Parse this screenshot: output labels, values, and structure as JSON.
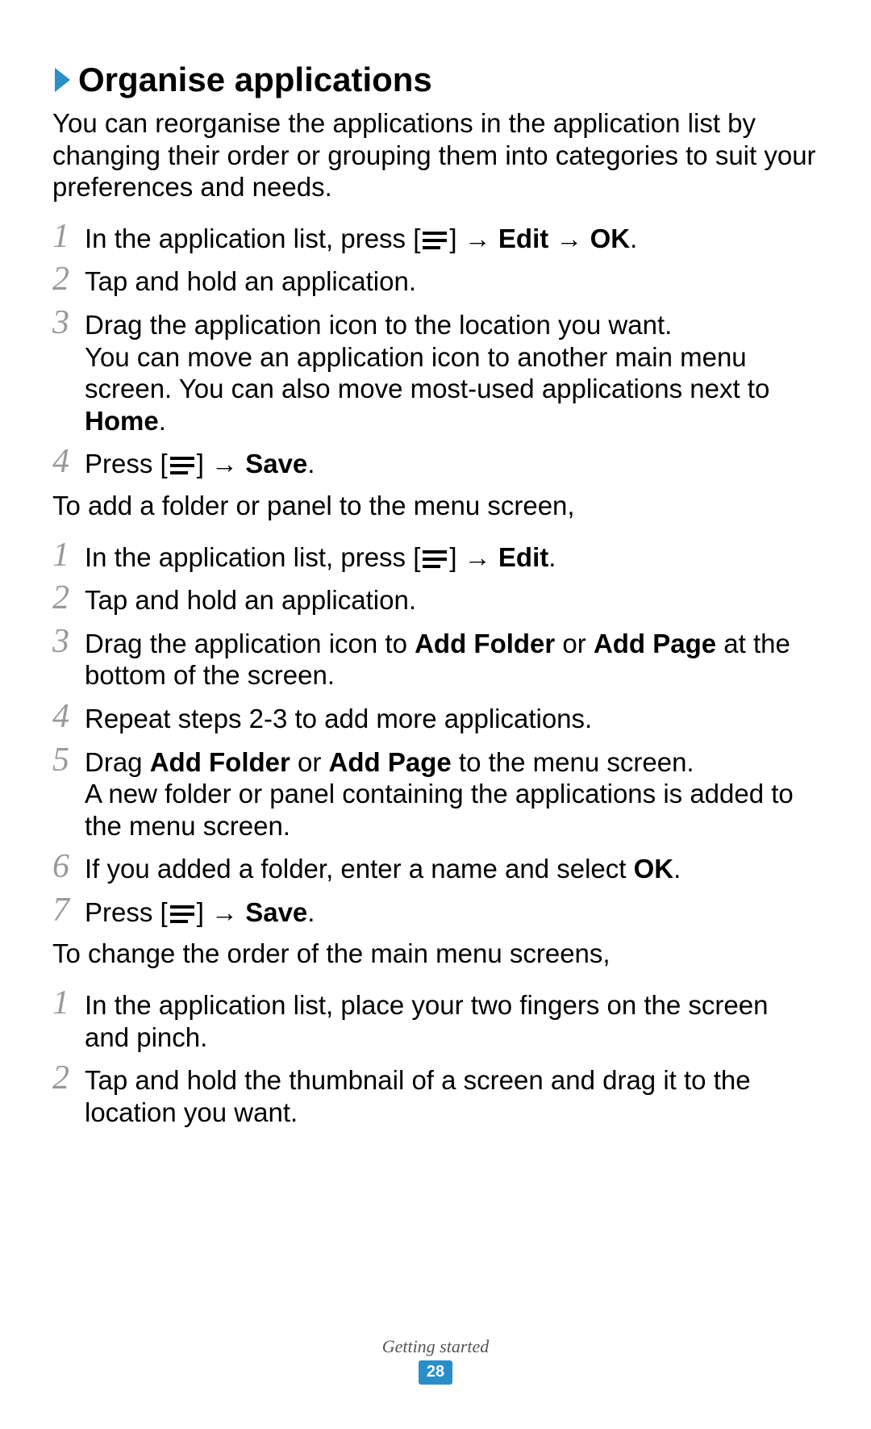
{
  "accent_color": "#2b8fc7",
  "heading": "Organise applications",
  "intro": "You can reorganise the applications in the application list by changing their order or grouping them into categories to suit your preferences and needs.",
  "icons": {
    "arrow": " → ",
    "menu_icon_label": "menu-icon"
  },
  "stepsA": [
    {
      "n": "1",
      "runs": [
        {
          "t": "In the application list, press ["
        },
        {
          "icon": "menu"
        },
        {
          "t": "]"
        },
        {
          "t": " → "
        },
        {
          "t": "Edit",
          "b": true
        },
        {
          "t": " → "
        },
        {
          "t": "OK",
          "b": true
        },
        {
          "t": "."
        }
      ]
    },
    {
      "n": "2",
      "runs": [
        {
          "t": "Tap and hold an application."
        }
      ]
    },
    {
      "n": "3",
      "runs": [
        {
          "t": "Drag the application icon to the location you want."
        },
        {
          "br": true
        },
        {
          "t": "You can move an application icon to another main menu screen. You can also move most-used applications next to "
        },
        {
          "t": "Home",
          "b": true
        },
        {
          "t": "."
        }
      ]
    },
    {
      "n": "4",
      "runs": [
        {
          "t": "Press ["
        },
        {
          "icon": "menu"
        },
        {
          "t": "]"
        },
        {
          "t": " → "
        },
        {
          "t": "Save",
          "b": true
        },
        {
          "t": "."
        }
      ]
    }
  ],
  "midPara1": "To add a folder or panel to the menu screen,",
  "stepsB": [
    {
      "n": "1",
      "runs": [
        {
          "t": "In the application list, press ["
        },
        {
          "icon": "menu"
        },
        {
          "t": "]"
        },
        {
          "t": " → "
        },
        {
          "t": "Edit",
          "b": true
        },
        {
          "t": "."
        }
      ]
    },
    {
      "n": "2",
      "runs": [
        {
          "t": "Tap and hold an application."
        }
      ]
    },
    {
      "n": "3",
      "runs": [
        {
          "t": "Drag the application icon to "
        },
        {
          "t": "Add Folder",
          "b": true
        },
        {
          "t": " or "
        },
        {
          "t": "Add Page",
          "b": true
        },
        {
          "t": " at the bottom of the screen."
        }
      ]
    },
    {
      "n": "4",
      "runs": [
        {
          "t": "Repeat steps 2-3 to add more applications."
        }
      ]
    },
    {
      "n": "5",
      "runs": [
        {
          "t": "Drag "
        },
        {
          "t": "Add Folder",
          "b": true
        },
        {
          "t": " or "
        },
        {
          "t": "Add Page",
          "b": true
        },
        {
          "t": " to the menu screen."
        },
        {
          "br": true
        },
        {
          "t": "A new folder or panel containing the applications is added to the menu screen."
        }
      ]
    },
    {
      "n": "6",
      "runs": [
        {
          "t": "If you added a folder, enter a name and select "
        },
        {
          "t": "OK",
          "b": true
        },
        {
          "t": "."
        }
      ]
    },
    {
      "n": "7",
      "runs": [
        {
          "t": "Press ["
        },
        {
          "icon": "menu"
        },
        {
          "t": "]"
        },
        {
          "t": " → "
        },
        {
          "t": "Save",
          "b": true
        },
        {
          "t": "."
        }
      ]
    }
  ],
  "midPara2": "To change the order of the main menu screens,",
  "stepsC": [
    {
      "n": "1",
      "runs": [
        {
          "t": "In the application list, place your two fingers on the screen and pinch."
        }
      ]
    },
    {
      "n": "2",
      "runs": [
        {
          "t": "Tap and hold the thumbnail of a screen and drag it to the location you want."
        }
      ]
    }
  ],
  "footer": {
    "section": "Getting started",
    "page": "28"
  }
}
